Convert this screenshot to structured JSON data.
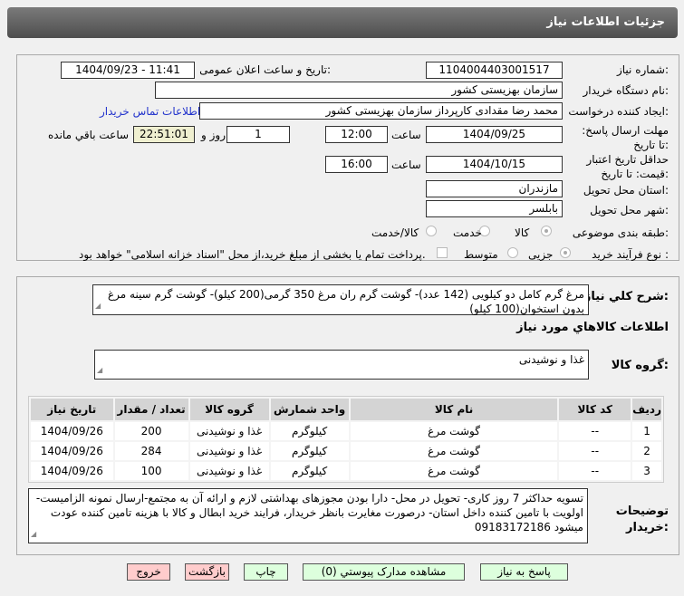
{
  "header": {
    "title": "جزئیات اطلاعات نیاز"
  },
  "form": {
    "need_number_label": "شماره نیاز:",
    "need_number": "1104004403001517",
    "announce_label": "تاریخ و ساعت اعلان عمومی:",
    "announce_value": "1404/09/23 - 11:41",
    "buyer_label": "نام دستگاه خریدار:",
    "buyer": "سازمان بهزیستی کشور",
    "creator_label": "ایجاد کننده درخواست:",
    "creator": "محمد رضا  مقدادی کارپرداز سازمان بهزیستی کشور",
    "contact_link": "اطلاعات تماس خریدار",
    "deadline_label": "مهلت ارسال پاسخ: تا تاریخ:",
    "deadline_date": "1404/09/25",
    "time_label": "ساعت",
    "deadline_time": "12:00",
    "days": "1",
    "days_label": "روز و",
    "remaining": "22:51:01",
    "remaining_label": "ساعت باقي مانده",
    "validity_label": "حداقل تاریخ اعتبار قیمت: تا تاریخ:",
    "validity_date": "1404/10/15",
    "validity_time": "16:00",
    "province_label": "استان محل تحویل:",
    "province": "مازندران",
    "city_label": "شهر محل تحویل:",
    "city": "بابلسر",
    "category_label": "طبقه بندی موضوعی:",
    "category_options": [
      "کالا",
      "خدمت",
      "کالا/خدمت"
    ],
    "process_label": "نوع فرآیند خرید :",
    "process_options": [
      "جزیی",
      "متوسط"
    ],
    "payment_note": "پرداخت تمام یا بخشی از مبلغ خرید،از محل \"اسناد خزانه اسلامی\" خواهد بود."
  },
  "details": {
    "desc_label": "شرح کلي نياز:",
    "desc": "مرغ گرم کامل دو کیلویی (142 عدد)- گوشت گرم ران مرغ 350 گرمی(200 کیلو)- گوشت گرم سینه مرغ بدون استخوان(100 کیلو)",
    "goods_info_title": "اطلاعات کالاهاي مورد نياز",
    "group_label": "گروه کالا:",
    "group": "غذا و نوشیدنی",
    "table_headers": [
      "ردیف",
      "کد کالا",
      "نام کالا",
      "واحد شمارش",
      "گروه کالا",
      "تعداد / مقدار",
      "تاریخ نیاز"
    ],
    "rows": [
      [
        "1",
        "--",
        "گوشت مرغ",
        "کیلوگرم",
        "غذا و نوشیدنی",
        "200",
        "1404/09/26"
      ],
      [
        "2",
        "--",
        "گوشت مرغ",
        "کیلوگرم",
        "غذا و نوشیدنی",
        "284",
        "1404/09/26"
      ],
      [
        "3",
        "--",
        "گوشت مرغ",
        "کیلوگرم",
        "غذا و نوشیدنی",
        "100",
        "1404/09/26"
      ]
    ],
    "notes_label": "توضیحات خریدار:",
    "notes": "تسویه حداکثر 7 روز کاری- تحویل در محل- دارا بودن مجوزهای بهداشتی لازم و ارائه آن به مجتمع-ارسال نمونه الزامیست- اولویت با تامین کننده داخل استان- درصورت مغایرت بانظر خریدار، فرایند خرید ابطال و کالا با هزینه تامین کننده عودت میشود 09183172186"
  },
  "buttons": {
    "reply": "پاسخ به نیاز",
    "docs": "مشاهده مدارک پیوستي (0)",
    "print": "چاپ",
    "back": "بازگشت",
    "exit": "خروج"
  }
}
